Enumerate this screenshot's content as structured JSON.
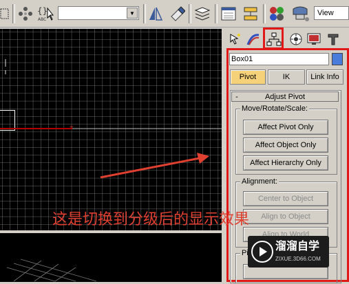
{
  "toolbar": {
    "view_label": "View"
  },
  "panel": {
    "object_name": "Box01",
    "object_color": "#4a7ddb",
    "mode_tabs": [
      "Pivot",
      "IK",
      "Link Info"
    ],
    "rollout_title": "Adjust Pivot",
    "rollout_toggle": "-",
    "move_group": {
      "title": "Move/Rotate/Scale:",
      "buttons": [
        "Affect Pivot Only",
        "Affect Object Only",
        "Affect Hierarchy Only"
      ]
    },
    "alignment_group": {
      "title": "Alignment:",
      "buttons": [
        "Center to Object",
        "Align to Object",
        "Align to World"
      ]
    },
    "partial_group_title": "Pi"
  },
  "annotation": {
    "text": "这是切换到分级后的显示效果",
    "color": "#e04030"
  },
  "watermark": {
    "brand": "溜溜自学",
    "url": "ZIXUE.3D66.COM"
  },
  "colors": {
    "highlight_frame": "#e01818",
    "pivot_tab_active": "#f5d27a"
  }
}
